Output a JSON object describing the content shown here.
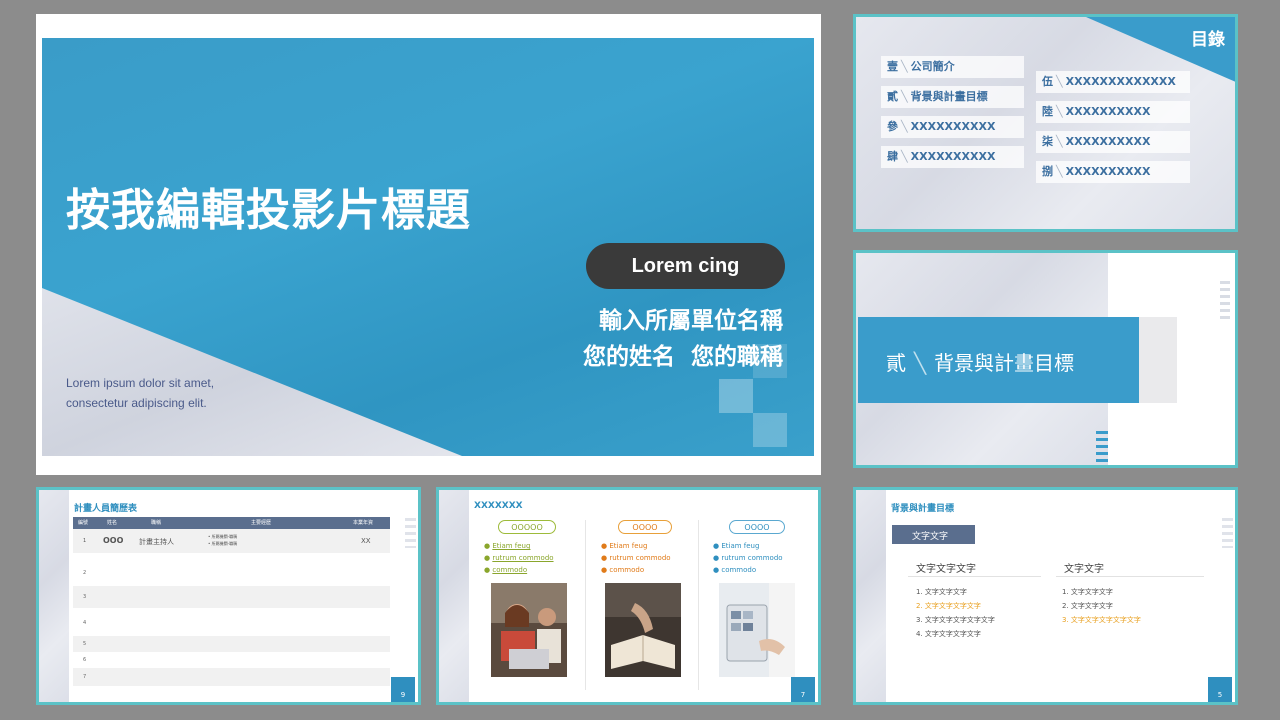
{
  "main": {
    "title": "按我編輯投影片標題",
    "pill": "Lorem cing",
    "org": "輸入所屬單位名稱",
    "name_line": "您的姓名  您的職稱",
    "lorem1": "Lorem ipsum dolor sit amet,",
    "lorem2": "consectetur adipiscing elit."
  },
  "toc": {
    "title": "目錄",
    "items": [
      {
        "num": "壹",
        "label": "公司簡介"
      },
      {
        "num": "貳",
        "label": "背景與計畫目標"
      },
      {
        "num": "參",
        "label": "XXXXXXXXXX"
      },
      {
        "num": "肆",
        "label": "XXXXXXXXXX"
      },
      {
        "num": "伍",
        "label": "XXXXXXXXXXXXX"
      },
      {
        "num": "陸",
        "label": "XXXXXXXXXX"
      },
      {
        "num": "柒",
        "label": "XXXXXXXXXX"
      },
      {
        "num": "捌",
        "label": "XXXXXXXXXX"
      }
    ]
  },
  "section": {
    "num": "貳",
    "title": "背景與計畫目標"
  },
  "table_slide": {
    "title": "計畫人員簡歷表",
    "headers": [
      "編號",
      "姓名",
      "職稱",
      "主要經歷",
      "本業年資"
    ],
    "row1": {
      "no": "1",
      "name": "OOO",
      "role": "計畫主持人",
      "exp1": "• 所屬機關-職稱",
      "exp2": "• 所屬機關-職稱",
      "years": "XX"
    },
    "row_nums": [
      "2",
      "3",
      "4",
      "5",
      "6",
      "7"
    ],
    "page": "9"
  },
  "photo_slide": {
    "title": "XXXXXXX",
    "cols": [
      {
        "pill": "OOOOO",
        "b1": "Etiam feug",
        "b2": "rutrum commodo",
        "b3": "commodo",
        "color": "#8aa62c"
      },
      {
        "pill": "OOOO",
        "b1": "Etiam feug",
        "b2": "rutrum commodo",
        "b3": "commodo",
        "color": "#e07b1a"
      },
      {
        "pill": "OOOO",
        "b1": "Etiam feug",
        "b2": "rutrum commodo",
        "b3": "commodo",
        "color": "#2f8fbf"
      }
    ],
    "page": "7"
  },
  "goals_slide": {
    "title": "背景與計畫目標",
    "tag": "文字文字",
    "col1_head": "文字文字文字",
    "col1_items": [
      "1. 文字文字文字",
      "2. 文字文字文字文字",
      "3. 文字文字文字文字文字",
      "4. 文字文字文字文字"
    ],
    "col2_head": "文字文字",
    "col2_items": [
      "1. 文字文字文字",
      "2. 文字文字文字",
      "3. 文字文字文字文字文字"
    ],
    "page": "5"
  },
  "colors": {
    "accent": "#3a9ccb",
    "teal_border": "#5bc2c7",
    "dark_pill": "#3a3a3a"
  }
}
